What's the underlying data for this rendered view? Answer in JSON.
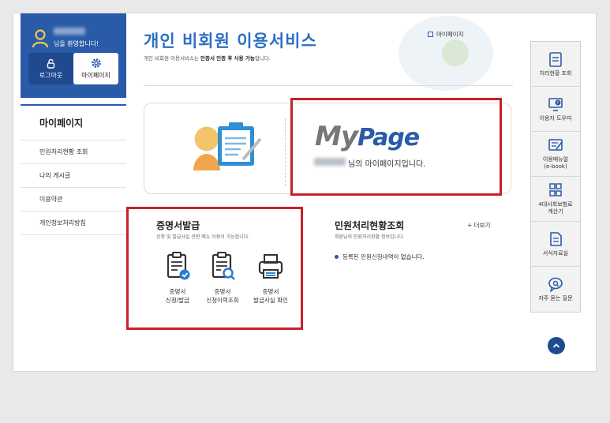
{
  "user": {
    "greeting": "님을 환영합니다!",
    "logout_label": "로그아웃",
    "mypage_label": "마이페이지"
  },
  "left_menu": {
    "title": "마이페이지",
    "items": [
      {
        "label": "민원처리현황 조회"
      },
      {
        "label": "나의 게시글"
      },
      {
        "label": "이용약관"
      },
      {
        "label": "개인정보처리방침"
      }
    ]
  },
  "header": {
    "title": "개인 비회원 이용서비스",
    "subtitle_pre": "개인 비회원 이용서비스는 ",
    "subtitle_bold": "인증서 인증 후 사용 가능",
    "subtitle_post": "합니다.",
    "breadcrumb": "마이페이지"
  },
  "banner": {
    "logo_my": "My",
    "logo_page": "Page",
    "text": "님의 마이페이지입니다."
  },
  "cert": {
    "title": "증명서발급",
    "subtitle": "신청 및 발급사실 관련 메뉴 이용이 가능합니다.",
    "items": [
      {
        "line1": "증명서",
        "line2": "신청/발급",
        "icon": "document-check-icon"
      },
      {
        "line1": "증명서",
        "line2": "신청이력조회",
        "icon": "document-search-icon"
      },
      {
        "line1": "증명서",
        "line2": "발급사실 확인",
        "icon": "printer-icon"
      }
    ]
  },
  "civil": {
    "title": "민원처리현황조회",
    "subtitle": "회원님의 민원처리현황 정보입니다.",
    "more": "+ 더보기",
    "empty_message": "등록된 민원신청내역이 없습니다."
  },
  "quick_menu": [
    {
      "label": "처리현황 조회",
      "icon": "clipboard-icon"
    },
    {
      "label": "이용자 도우미",
      "icon": "help-monitor-icon"
    },
    {
      "label": "이용매뉴얼\n(e-book)",
      "icon": "manual-icon"
    },
    {
      "label": "4대사회보험료\n계산기",
      "icon": "calculator-icon"
    },
    {
      "label": "서식자료실",
      "icon": "form-document-icon"
    },
    {
      "label": "자주 묻는 질문",
      "icon": "faq-icon"
    }
  ],
  "colors": {
    "brand_blue": "#2a5ba8",
    "title_blue": "#2d6fc3",
    "highlight_red": "#c8202a"
  }
}
